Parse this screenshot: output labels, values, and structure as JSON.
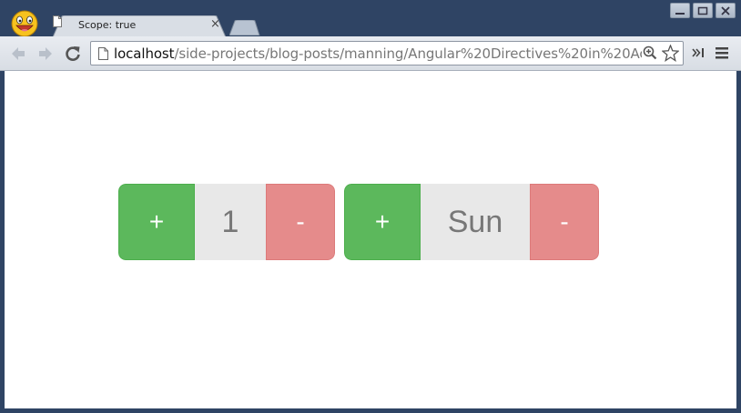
{
  "browser": {
    "tab_title": "Scope: true",
    "tab_close": "×",
    "url_host": "localhost",
    "url_path": "/side-projects/blog-posts/manning/Angular%20Directives%20in%20Act",
    "icons": {
      "logo": "smiley-logo-icon",
      "back": "back-arrow-icon",
      "forward": "forward-arrow-icon",
      "reload": "reload-icon",
      "page": "page-icon",
      "zoom": "zoom-icon",
      "star": "star-icon",
      "extension": "extension-icon",
      "menu": "menu-icon"
    }
  },
  "spinners": [
    {
      "plus_label": "+",
      "value": "1",
      "minus_label": "-"
    },
    {
      "plus_label": "+",
      "value": "Sun",
      "minus_label": "-"
    }
  ],
  "colors": {
    "plus": "#5cb85c",
    "value_bg": "#e8e8e8",
    "minus": "#e58b8b",
    "chrome": "#2f4464"
  }
}
